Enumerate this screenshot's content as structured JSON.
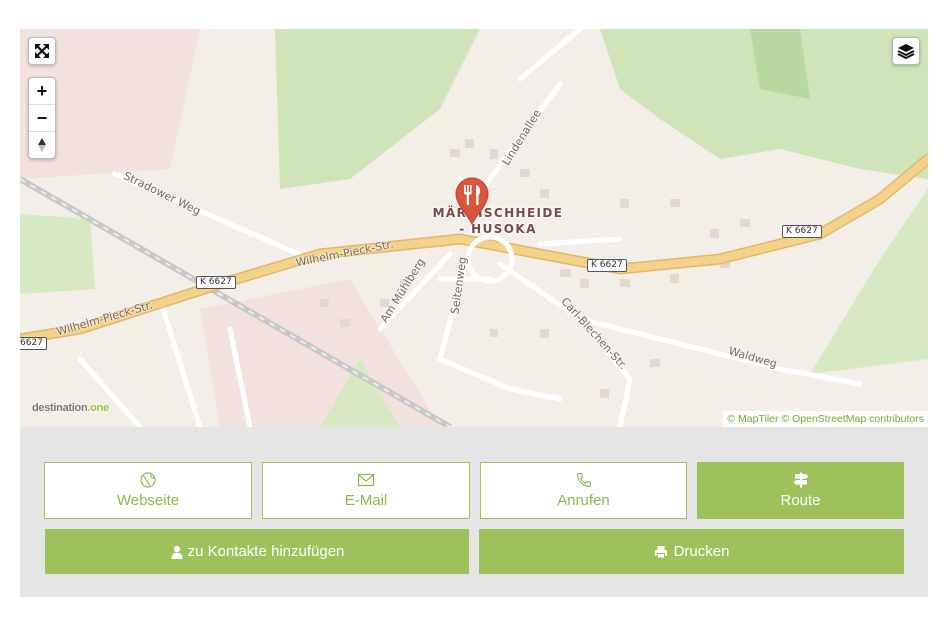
{
  "map": {
    "place_label": [
      "MÄRKISCHHEIDE",
      "- HUSOKA"
    ],
    "pin_icon": "restaurant-icon",
    "streets": {
      "wilhelm_pieck_upper": "Wilhelm-Pieck-Str.",
      "wilhelm_pieck_lower": "Wilhelm-Pieck-Str.",
      "stradower_weg": "Stradower Weg",
      "lindenallee": "Lindenallee",
      "am_muehlberg": "Am Mühlberg",
      "seitenweg": "Seitenweg",
      "carl_blechen": "Carl-Blechen-Str.",
      "waldweg": "Waldweg"
    },
    "road_shields": [
      "K 6627",
      "K 6627",
      "K 6627",
      "6627"
    ],
    "watermark": {
      "text": "destination",
      "suffix": ".one"
    },
    "attribution": {
      "maptiler": "© MapTiler",
      "osm": "© OpenStreetMap contributors"
    },
    "controls": {
      "fullscreen": "fullscreen-icon",
      "zoom_in": "+",
      "zoom_out": "−",
      "north": "compass-icon",
      "layers": "layers-icon"
    }
  },
  "actions": {
    "website": {
      "label": "Webseite",
      "icon": "globe-icon"
    },
    "email": {
      "label": "E-Mail",
      "icon": "envelope-icon"
    },
    "call": {
      "label": "Anrufen",
      "icon": "phone-icon"
    },
    "route": {
      "label": "Route",
      "icon": "signpost-icon"
    },
    "add_contact": {
      "label": "zu Kontakte hinzufügen",
      "icon": "user-icon"
    },
    "print": {
      "label": "Drucken",
      "icon": "printer-icon"
    }
  },
  "colors": {
    "accent": "#9ec15c",
    "accent_text": "#8cb84e",
    "panel": "#e5e5e5",
    "road": "#f5d28a",
    "forest": "#cde5b5",
    "pin": "#d9553c"
  }
}
